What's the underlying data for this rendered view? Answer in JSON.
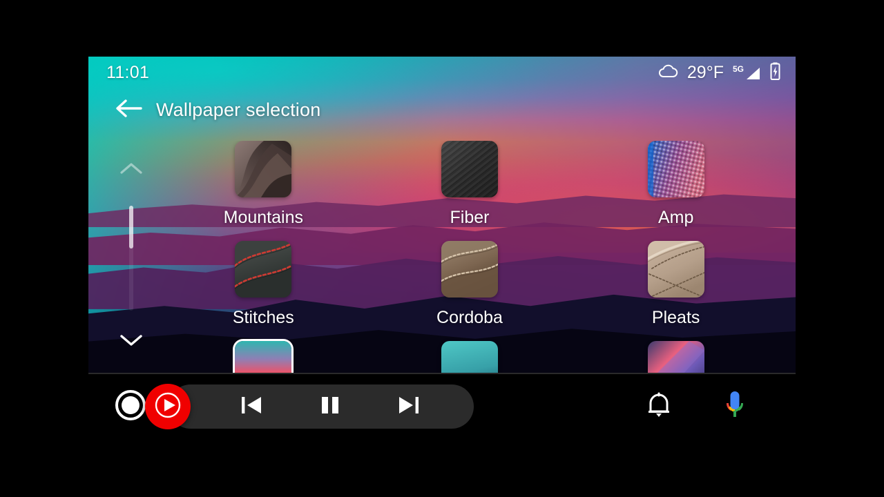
{
  "status_bar": {
    "clock": "11:01",
    "weather_icon": "cloud-icon",
    "temperature": "29°F",
    "network_label": "5G",
    "signal_icon": "signal-bars-icon",
    "battery_icon": "battery-charging-icon"
  },
  "header": {
    "back_icon": "arrow-left-icon",
    "title": "Wallpaper selection"
  },
  "scroll": {
    "up_icon": "chevron-up-icon",
    "down_icon": "chevron-down-icon",
    "thumb": "scrollbar-thumb"
  },
  "grid": {
    "items": [
      {
        "label": "Mountains",
        "thumb": "mountains-swatch",
        "selected": false
      },
      {
        "label": "Fiber",
        "thumb": "fiber-swatch",
        "selected": false
      },
      {
        "label": "Amp",
        "thumb": "amp-swatch",
        "selected": false
      },
      {
        "label": "Stitches",
        "thumb": "stitches-swatch",
        "selected": false
      },
      {
        "label": "Cordoba",
        "thumb": "cordoba-swatch",
        "selected": false
      },
      {
        "label": "Pleats",
        "thumb": "pleats-swatch",
        "selected": false
      },
      {
        "label": "",
        "thumb": "sunset-swatch",
        "selected": true
      },
      {
        "label": "",
        "thumb": "teal-swatch",
        "selected": false
      },
      {
        "label": "",
        "thumb": "aurora-swatch",
        "selected": false
      }
    ]
  },
  "nav_bar": {
    "home_icon": "home-circle-icon",
    "play_icon": "play-circle-icon",
    "prev_icon": "skip-previous-icon",
    "pause_icon": "pause-icon",
    "next_icon": "skip-next-icon",
    "notifications_icon": "bell-icon",
    "assistant_icon": "microphone-icon"
  },
  "colors": {
    "accent_red": "#f00000",
    "pill_background": "#2b2b2b",
    "nav_background": "#000000",
    "text_primary": "#ffffff"
  }
}
